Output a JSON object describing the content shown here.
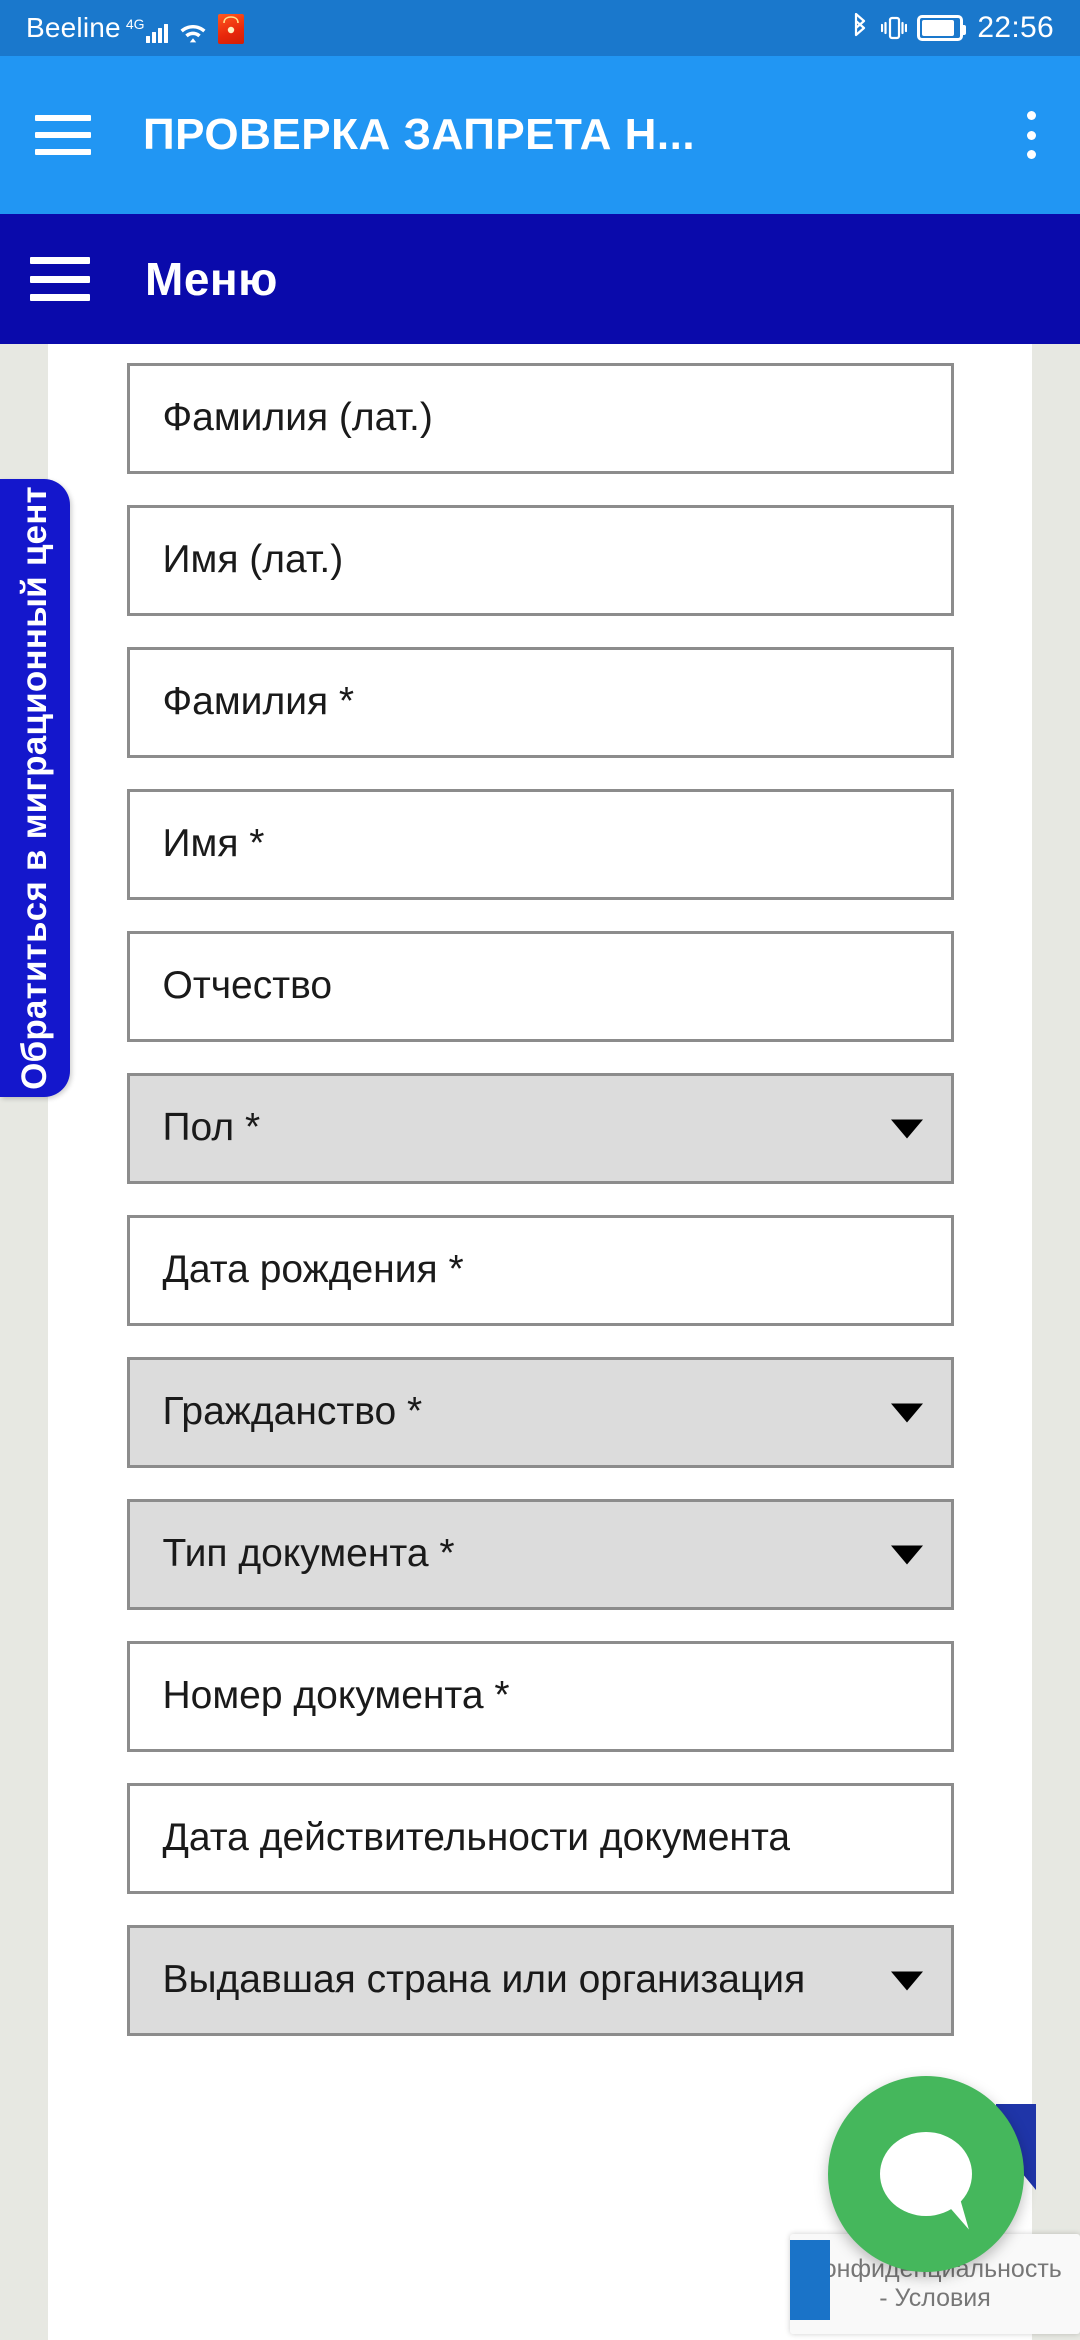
{
  "status_bar": {
    "carrier": "Beeline",
    "network_type": "4G",
    "icons": [
      "signal-bars-icon",
      "wifi-icon",
      "app-notification-icon",
      "bluetooth-icon",
      "vibrate-icon",
      "battery-icon"
    ],
    "time": "22:56",
    "background_color": "#1A78CC"
  },
  "app_bar": {
    "menu_icon": "hamburger-icon",
    "title": "ПРОВЕРКА ЗАПРЕТА Н...",
    "overflow_icon": "kebab-menu-icon",
    "background_color": "#2196F3"
  },
  "menu_strip": {
    "menu_icon": "hamburger-icon",
    "label": "Меню",
    "background_color": "#0A0AAB"
  },
  "side_tab": {
    "label": "Обратиться в миграционный цент",
    "background_color": "#1417CC"
  },
  "form": {
    "fields": [
      {
        "label": "Фамилия (лат.)",
        "type": "text"
      },
      {
        "label": "Имя (лат.)",
        "type": "text"
      },
      {
        "label": "Фамилия *",
        "type": "text"
      },
      {
        "label": "Имя *",
        "type": "text"
      },
      {
        "label": "Отчество",
        "type": "text"
      },
      {
        "label": "Пол *",
        "type": "select"
      },
      {
        "label": "Дата рождения *",
        "type": "text"
      },
      {
        "label": "Гражданство *",
        "type": "select"
      },
      {
        "label": "Тип документа *",
        "type": "select"
      },
      {
        "label": "Номер документа *",
        "type": "text"
      },
      {
        "label": "Дата действительности документа",
        "type": "text"
      },
      {
        "label": "Выдавшая страна или организация",
        "type": "select"
      }
    ],
    "dropdown_icon": "caret-down-icon",
    "select_background": "#DCDCDC",
    "border_color": "#8C8C8C"
  },
  "recaptcha": {
    "privacy": "Конфиденциальность",
    "terms": "- Условия"
  },
  "chat_button": {
    "icon": "chat-bubble-icon",
    "color": "#45B75C"
  }
}
